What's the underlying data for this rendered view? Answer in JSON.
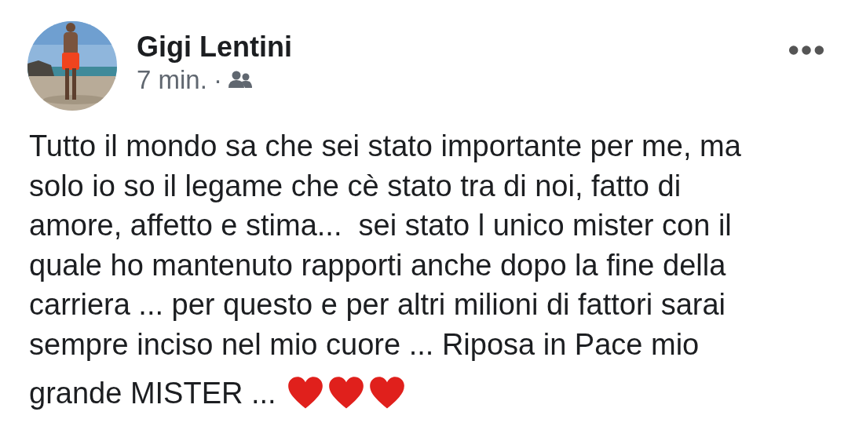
{
  "post": {
    "author": "Gigi Lentini",
    "time": "7 min.",
    "separator": "·",
    "audience_icon": {
      "kind": "friends"
    },
    "lines": [
      "Tutto il mondo sa che sei stato importante per me, ma",
      "solo io so il legame che cè stato tra di noi, fatto di",
      "amore, affetto e stima...  sei stato l unico mister con il",
      "quale ho mantenuto rapporti anche dopo la fine della",
      "carriera ... per questo e per altri milioni di fattori sarai",
      "sempre inciso nel mio cuore ... Riposa in Pace mio",
      "grande MISTER ..."
    ],
    "emojis": [
      {
        "kind": "heart"
      },
      {
        "kind": "heart"
      },
      {
        "kind": "heart"
      }
    ]
  }
}
